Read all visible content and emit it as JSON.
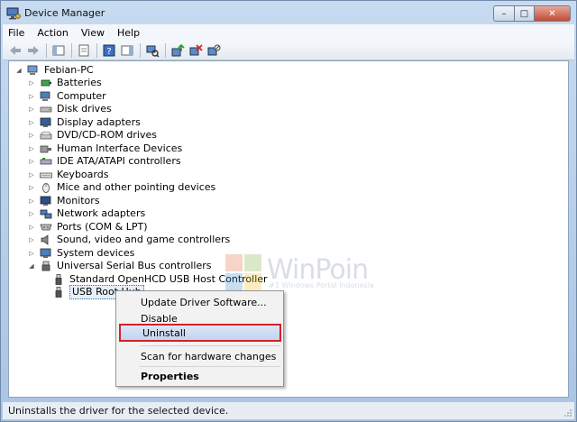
{
  "window": {
    "title": "Device Manager",
    "minimize": "–",
    "maximize": "□",
    "close": "✕"
  },
  "menu": [
    "File",
    "Action",
    "View",
    "Help"
  ],
  "tree": {
    "root": "Febian-PC",
    "items": [
      "Batteries",
      "Computer",
      "Disk drives",
      "Display adapters",
      "DVD/CD-ROM drives",
      "Human Interface Devices",
      "IDE ATA/ATAPI controllers",
      "Keyboards",
      "Mice and other pointing devices",
      "Monitors",
      "Network adapters",
      "Ports (COM & LPT)",
      "Sound, video and game controllers",
      "System devices",
      "Universal Serial Bus controllers"
    ],
    "usb_children": [
      "Standard OpenHCD USB Host Controller",
      "USB Root Hub"
    ],
    "expander_collapsed": "▷",
    "expander_expanded": "◢"
  },
  "context_menu": {
    "items": [
      "Update Driver Software...",
      "Disable",
      "Uninstall",
      "Scan for hardware changes",
      "Properties"
    ],
    "highlighted": "Uninstall",
    "highlight_color": "#d2222a"
  },
  "status": {
    "text": "Uninstalls the driver for the selected device."
  },
  "watermark": {
    "brand": "WinPoin",
    "tagline": "#1 Windows Portal Indonesia"
  },
  "colors": {
    "title_bar": "#c7daf0",
    "selection": "#e6eef8",
    "close_button": "#c24a36"
  }
}
